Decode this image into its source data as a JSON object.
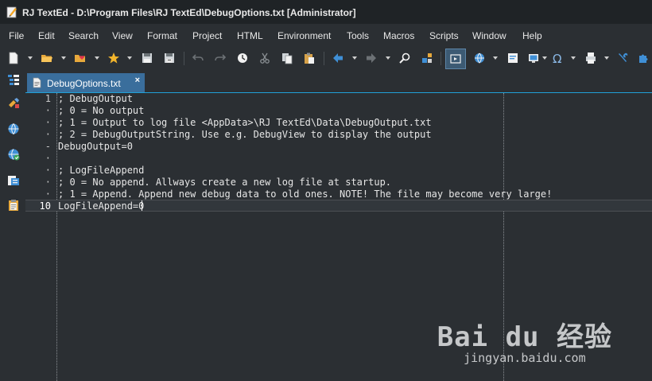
{
  "window": {
    "title": "RJ TextEd - D:\\Program Files\\RJ TextEd\\DebugOptions.txt [Administrator]"
  },
  "menu": [
    "File",
    "Edit",
    "Search",
    "View",
    "Format",
    "Project",
    "HTML",
    "Environment",
    "Tools",
    "Macros",
    "Scripts",
    "Window",
    "Help"
  ],
  "toolbar_icons": [
    "new-file-icon",
    "open-folder-icon",
    "favorites-icon",
    "bookmark-star-icon",
    "save-icon",
    "save-all-icon",
    "undo-icon",
    "redo-icon",
    "history-icon",
    "cut-icon",
    "copy-icon",
    "paste-icon",
    "back-arrow-icon",
    "forward-arrow-icon",
    "find-icon",
    "plugin-icon",
    "preview-icon",
    "browser-icon",
    "code-icon",
    "screen-icon",
    "omega-icon",
    "print-icon",
    "tools-icon",
    "puzzle-icon"
  ],
  "sidebar_icons": [
    "file-explorer-icon",
    "clip-tool-icon",
    "globe-icon",
    "ftp-icon",
    "document-map-icon",
    "clipboard-icon"
  ],
  "tab": {
    "label": "DebugOptions.txt",
    "close": "×"
  },
  "editor": {
    "lines": [
      {
        "num": "1",
        "text": "; DebugOutput"
      },
      {
        "num": "·",
        "text": "; 0 = No output"
      },
      {
        "num": "·",
        "text": "; 1 = Output to log file <AppData>\\RJ TextEd\\Data\\DebugOutput.txt"
      },
      {
        "num": "·",
        "text": "; 2 = DebugOutputString. Use e.g. DebugView to display the output"
      },
      {
        "num": "-",
        "text": "DebugOutput=0"
      },
      {
        "num": "·",
        "text": ""
      },
      {
        "num": "·",
        "text": "; LogFileAppend"
      },
      {
        "num": "·",
        "text": "; 0 = No append. Allways create a new log file at startup."
      },
      {
        "num": "·",
        "text": "; 1 = Append. Append new debug data to old ones. NOTE! The file may become very large!"
      },
      {
        "num": "10",
        "text": "LogFileAppend=0"
      }
    ]
  },
  "watermark": {
    "logo": "Bai du 经验",
    "url": "jingyan.baidu.com"
  },
  "colors": {
    "background": "#2b2f33",
    "tab_active": "#3a6e9c",
    "accent": "#20a0d8"
  }
}
